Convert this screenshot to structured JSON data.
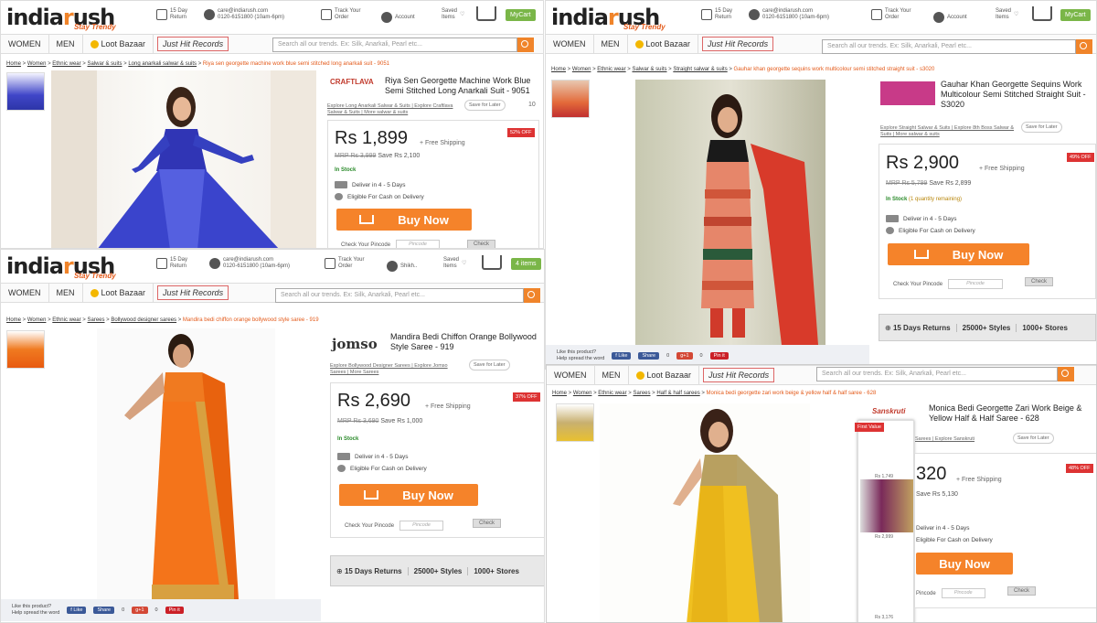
{
  "header": {
    "logo_a": "india",
    "logo_r": "r",
    "logo_b": "ush",
    ".com": ".com",
    "tagline": "Stay Trendy",
    "returns": "15 Day\nReturn",
    "contact": "care@indiarush.com\n0120-6151800 (10am-6pm)",
    "track": "Track Your\nOrder",
    "account": "Account",
    "saved": "Saved\nItems",
    "mycart": "MyCart",
    "account2": "Shikh..",
    "mycart2": "4 items"
  },
  "nav": {
    "women": "WOMEN",
    "men": "MEN",
    "loot": "Loot Bazaar",
    "jhr": "Just Hit Records",
    "search_placeholder": "Search all our trends. Ex: Silk, Anarkali, Pearl etc..."
  },
  "products": [
    {
      "breadcrumb": [
        "Home",
        ">",
        "Women",
        ">",
        "Ethnic wear",
        ">",
        "Salwar & suits",
        ">",
        "Long anarkali salwar & suits",
        ">"
      ],
      "current": "Riya sen georgette machine work blue semi stitched long anarkali suit - 9051",
      "brand": "CRAFTLAVA",
      "title": "Riya Sen Georgette Machine Work Blue Semi Stitched Long Anarkali Suit - 9051",
      "explore": "Explore Long Anarkali Salwar & Suits | Explore Craftlava Salwar & Suits | More salwar & suits",
      "save": "Save for Later",
      "price": "Rs 1,899",
      "free": "+ Free Shipping",
      "off": "52% OFF",
      "mrp_label": "MRP",
      "mrp": "Rs 3,999",
      "save_amt": "Save Rs 2,100",
      "stock": "In Stock",
      "deliver": "Deliver in 4 - 5 Days",
      "cod": "Eligible For Cash on Delivery",
      "buy": "Buy Now",
      "pincode_label": "Check Your Pincode",
      "pincode_ph": "Pincode",
      "check": "Check",
      "count": "10"
    },
    {
      "breadcrumb": [
        "Home",
        ">",
        "Women",
        ">",
        "Ethnic wear",
        ">",
        "Salwar & suits",
        ">",
        "Straight salwar & suits",
        ">"
      ],
      "current": "Gauhar khan georgette sequins work multicolour semi stitched straight suit - s3020",
      "brand": "Gauhar Khan",
      "title": "Gauhar Khan Georgette Sequins Work Multicolour Semi Stitched Straight Suit - S3020",
      "explore": "Explore Straight Salwar & Suits | Explore 8th Boss Salwar & Suits | More salwar & suits",
      "save": "Save for Later",
      "price": "Rs 2,900",
      "free": "+ Free Shipping",
      "off": "49% OFF",
      "mrp_label": "MRP",
      "mrp": "Rs 5,799",
      "save_amt": "Save Rs 2,899",
      "stock": "In Stock",
      "stock_note": "(1 quantity remaining)",
      "deliver": "Deliver in 4 - 5 Days",
      "cod": "Eligible For Cash on Delivery",
      "buy": "Buy Now",
      "pincode_label": "Check Your Pincode",
      "pincode_ph": "Pincode",
      "check": "Check",
      "stats": [
        "15 Days Returns",
        "25000+ Styles",
        "1000+ Stores"
      ],
      "social": {
        "like": "Like this product?",
        "help": "Help spread the word",
        "fb": "f Like",
        "share": "Share",
        "fb_count": "0",
        "gp": "g+1",
        "gp_count": "0",
        "pin": "Pin it"
      }
    },
    {
      "breadcrumb": [
        "Home",
        ">",
        "Women",
        ">",
        "Ethnic wear",
        ">",
        "Sarees",
        ">",
        "Bollywood designer sarees",
        ">"
      ],
      "current": "Mandira bedi chiffon orange bollywood style saree - 919",
      "brand": "jomso",
      "title": "Mandira Bedi Chiffon Orange Bollywood Style Saree - 919",
      "explore": "Explore Bollywood Designer Sarees | Explore Jomso Sarees | More Sarees",
      "save": "Save for Later",
      "price": "Rs 2,690",
      "free": "+ Free Shipping",
      "off": "37% OFF",
      "mrp_label": "MRP",
      "mrp": "Rs 3,690",
      "save_amt": "Save Rs 1,000",
      "stock": "In Stock",
      "deliver": "Deliver in 4 - 5 Days",
      "cod": "Eligible For Cash on Delivery",
      "buy": "Buy Now",
      "pincode_label": "Check Your Pincode",
      "pincode_ph": "Pincode",
      "check": "Check",
      "stats": [
        "15 Days Returns",
        "25000+ Styles",
        "1000+ Stores"
      ],
      "social": {
        "like": "Like this product?",
        "help": "Help spread the word",
        "fb": "f Like",
        "share": "Share",
        "fb_count": "0",
        "gp": "g+1",
        "gp_count": "0",
        "pin": "Pin it"
      }
    },
    {
      "breadcrumb": [
        "Home",
        ">",
        "Women",
        ">",
        "Ethnic wear",
        ">",
        "Sarees",
        ">",
        "Half & half sarees",
        ">"
      ],
      "current": "Monica bedi georgette zari work beige & yellow half & half saree - 628",
      "brand": "Sanskruti",
      "title": "Monica Bedi Georgette Zari Work Beige & Yellow Half & Half Saree - 628",
      "explore": "Sarees | Explore Sanskruti",
      "save": "Save for Later",
      "price": "320",
      "free": "+ Free Shipping",
      "off": "48% OFF",
      "first_value": "First Value",
      "side_prices": [
        "Rs 1,749",
        "Rs 2,999",
        "Rs 3,176"
      ],
      "save_amt": "Save Rs 5,130",
      "deliver": "Deliver in 4 - 5 Days",
      "cod": "Eligible For Cash on Delivery",
      "buy": "Buy Now",
      "pincode_label": "Pincode",
      "pincode_ph": "Pincode",
      "check": "Check"
    }
  ],
  "colors": {
    "accent": "#f5832a",
    "brand_orange": "#e35a1a",
    "green": "#7ab648",
    "offer": "#d33333"
  }
}
